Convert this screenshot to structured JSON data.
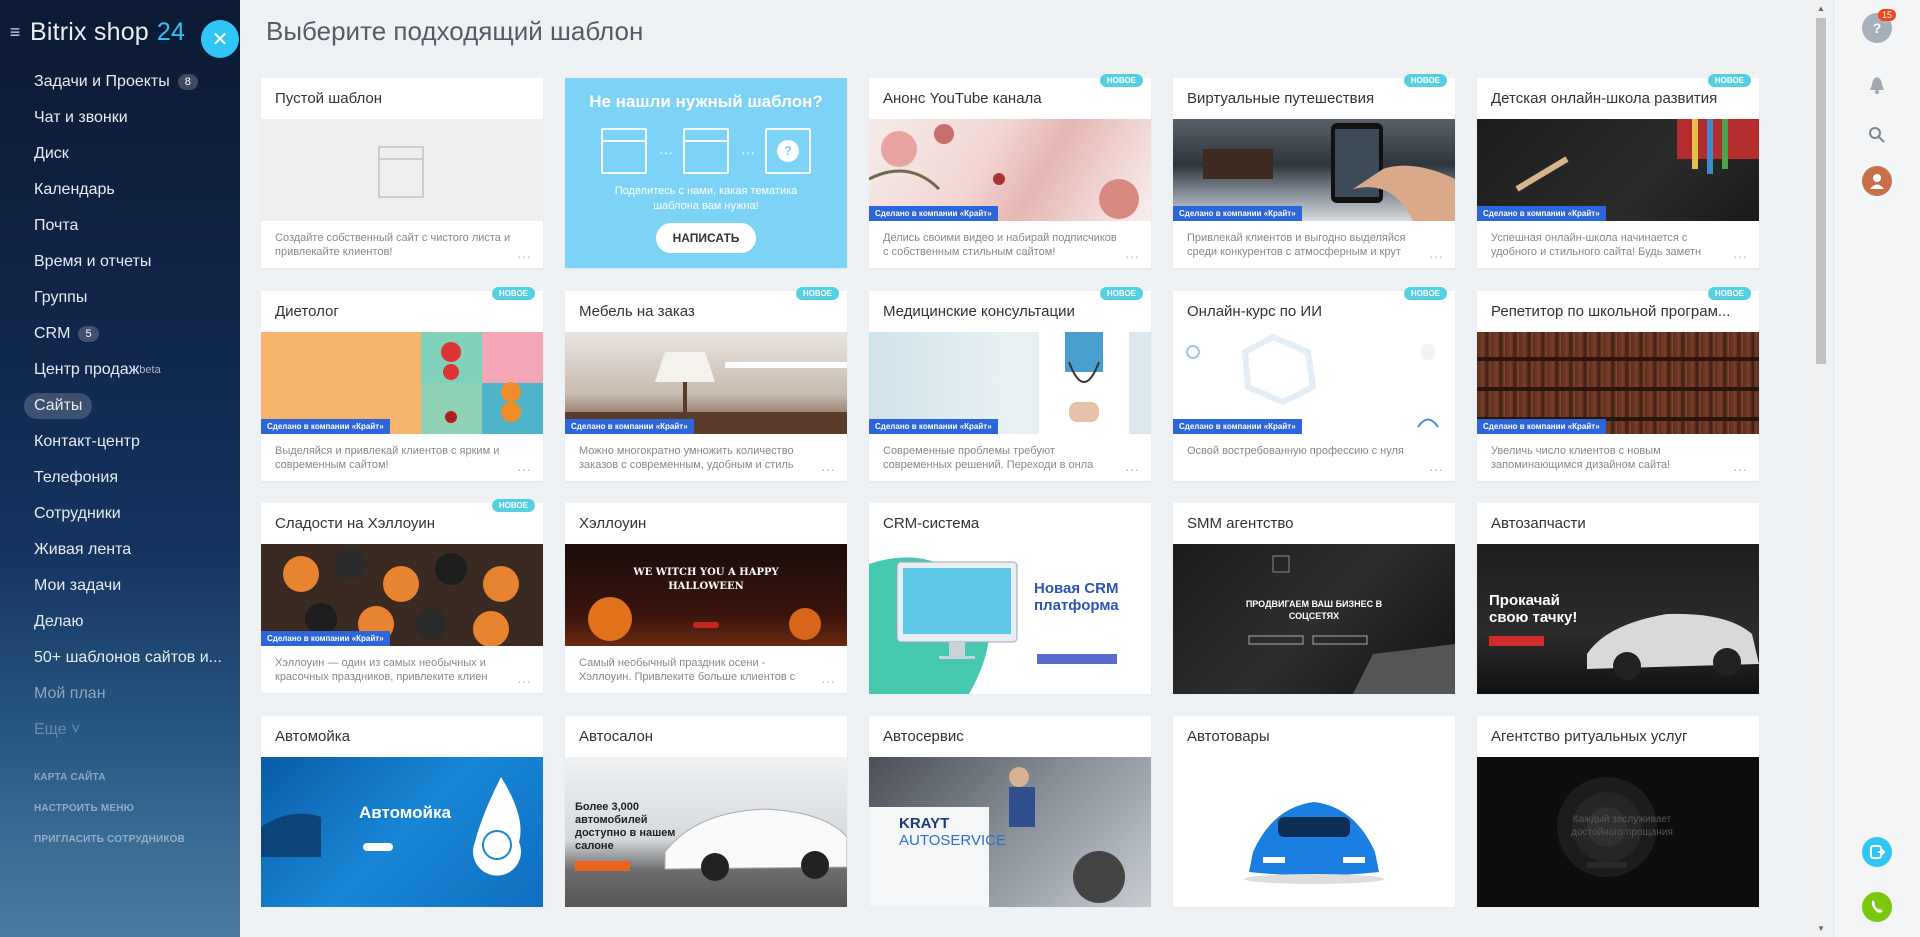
{
  "sidebar": {
    "logo_text": "Bitrix shop",
    "logo_num": "24",
    "items": [
      {
        "label": "Задачи и Проекты",
        "counter": "8"
      },
      {
        "label": "Чат и звонки"
      },
      {
        "label": "Диск"
      },
      {
        "label": "Календарь"
      },
      {
        "label": "Почта"
      },
      {
        "label": "Время и отчеты"
      },
      {
        "label": "Группы"
      },
      {
        "label": "CRM",
        "counter": "5"
      },
      {
        "label": "Центр продаж",
        "sup": "beta"
      },
      {
        "label": "Сайты"
      },
      {
        "label": "Контакт-центр"
      },
      {
        "label": "Телефония"
      },
      {
        "label": "Сотрудники"
      },
      {
        "label": "Живая лента"
      },
      {
        "label": "Мои задачи"
      },
      {
        "label": "Делаю"
      },
      {
        "label": "50+ шаблонов сайтов и..."
      },
      {
        "label": "Мой план"
      },
      {
        "label": "Еще"
      }
    ],
    "footer": [
      "КАРТА САЙТА",
      "НАСТРОИТЬ МЕНЮ",
      "ПРИГЛАСИТЬ СОТРУДНИКОВ"
    ]
  },
  "main": {
    "title": "Выберите подходящий шаблон",
    "badge_new": "НОВОЕ",
    "krayt_label": "Сделано в компании «Крайт»",
    "special": {
      "title": "Не нашли нужный шаблон?",
      "text": "Поделитесь с нами, какая тематика шаблона вам нужна!",
      "button": "НАПИСАТЬ"
    },
    "cards": [
      {
        "title": "Пустой шаблон",
        "desc": "Создайте собственный сайт с чистого листа и привлекайте клиентов!"
      },
      {
        "title": "Анонс YouTube канала",
        "desc": "Делись своими видео и набирай подписчиков с собственным стильным сайтом!"
      },
      {
        "title": "Виртуальные путешествия",
        "desc": "Привлекай клиентов и выгодно выделяйся среди конкурентов с атмосферным и крут"
      },
      {
        "title": "Детская онлайн-школа развития",
        "desc": "Успешная онлайн-школа начинается с удобного и стильного сайта! Будь заметн"
      },
      {
        "title": "Диетолог",
        "desc": "Выделяйся и привлекай клиентов с ярким и современным сайтом!"
      },
      {
        "title": "Мебель на заказ",
        "desc": "Можно многократно умножить количество заказов с современным, удобным и стиль"
      },
      {
        "title": "Медицинские консультации",
        "desc": "Современные проблемы требуют современных решений. Переходи в онла"
      },
      {
        "title": "Онлайн-курс по ИИ",
        "desc": "Освой востребованную профессию с нуля"
      },
      {
        "title": "Репетитор по школьной програм...",
        "desc": "Увеличь число клиентов с новым запоминающимся дизайном сайта!"
      },
      {
        "title": "Сладости на Хэллоуин",
        "desc": "Хэллоуин — один из самых необычных и красочных праздников, привлеките клиен"
      },
      {
        "title": "Хэллоуин",
        "desc": "Самый необычный праздник осени - Хэллоуин. Привлеките больше клиентов с помощь"
      },
      {
        "title": "CRM-система"
      },
      {
        "title": "SMM агентство"
      },
      {
        "title": "Автозапчасти"
      },
      {
        "title": "Автомойка"
      },
      {
        "title": "Автосалон"
      },
      {
        "title": "Автосервис"
      },
      {
        "title": "Автотовары"
      },
      {
        "title": "Агентство ритуальных услуг"
      }
    ],
    "previews": {
      "halloween": "WE WITCH YOU A HAPPY HALLOWEEN",
      "crm_h1": "Новая CRM платформа",
      "smm": "ПРОДВИГАЕМ ВАШ БИЗНЕС В СОЦСЕТЯХ",
      "parts": "Прокачай свою тачку!",
      "wash": "Автомойка",
      "salon": "Более 3,000 автомобилей доступно в нашем салоне",
      "service1": "KRAYT",
      "service2": "AUTOSERVICE",
      "ritual": "Каждый заслуживает достойного прощания"
    }
  },
  "right_panel": {
    "help_count": "15"
  }
}
